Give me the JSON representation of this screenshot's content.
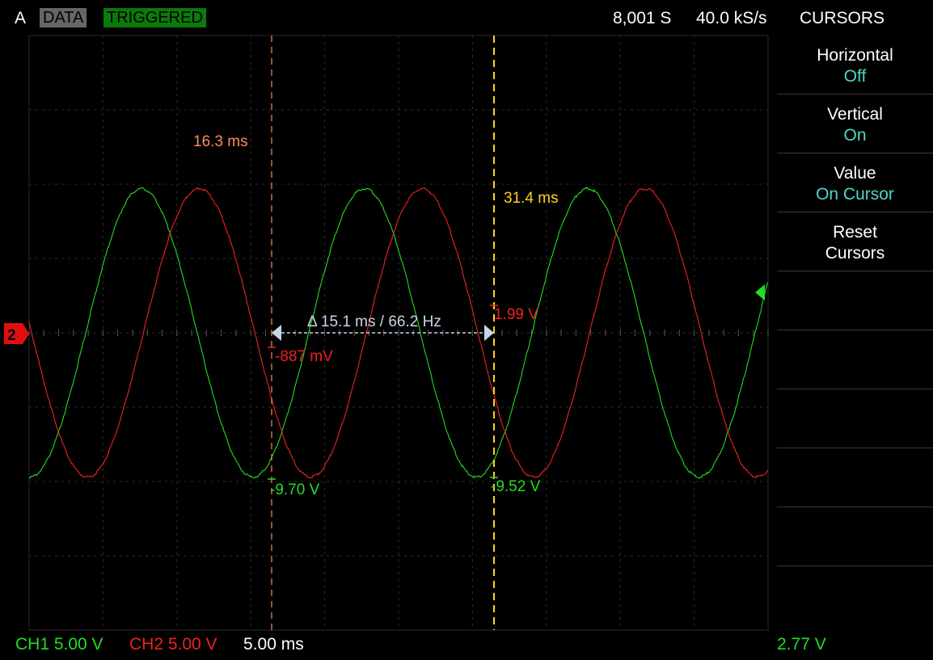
{
  "header": {
    "channel": "A",
    "data_badge": "DATA",
    "triggered_badge": "TRIGGERED",
    "samples": "8,001 S",
    "rate": "40.0 kS/s",
    "mode": "CURSORS"
  },
  "menu": [
    {
      "label": "Horizontal",
      "value": "Off"
    },
    {
      "label": "Vertical",
      "value": "On"
    },
    {
      "label": "Value",
      "value": "On Cursor"
    },
    {
      "label": "Reset",
      "value": "Cursors"
    }
  ],
  "cursors": {
    "c1_time": "16.3 ms",
    "c2_time": "31.4 ms",
    "delta": "Δ 15.1 ms / 66.2 Hz",
    "c1_ch2": "-887 mV",
    "c2_ch2": "1.99 V",
    "c1_ch1": "-9.70 V",
    "c2_ch1": "-9.52 V"
  },
  "channel_marker": "2",
  "footer": {
    "ch1": "CH1 5.00 V",
    "ch2": "CH2 5.00 V",
    "timebase": "5.00 ms",
    "trigger_level": "2.77 V"
  },
  "colors": {
    "ch1": "#22dd22",
    "ch2": "#ee2222",
    "cursor1": "#ff8c5a",
    "cursor2": "#ffd21f",
    "menu_value": "#4fd6c8"
  },
  "chart_data": {
    "type": "line",
    "title": "",
    "xlabel": "",
    "ylabel": "",
    "xlim": [
      0,
      50
    ],
    "ylim": [
      -20,
      20
    ],
    "series": [
      {
        "name": "CH1",
        "amplitude_v": 9.7,
        "period_ms": 15.1,
        "peak_ms": 7.6
      },
      {
        "name": "CH2",
        "amplitude_v": 9.7,
        "period_ms": 15.1,
        "peak_ms": 11.5
      }
    ]
  }
}
